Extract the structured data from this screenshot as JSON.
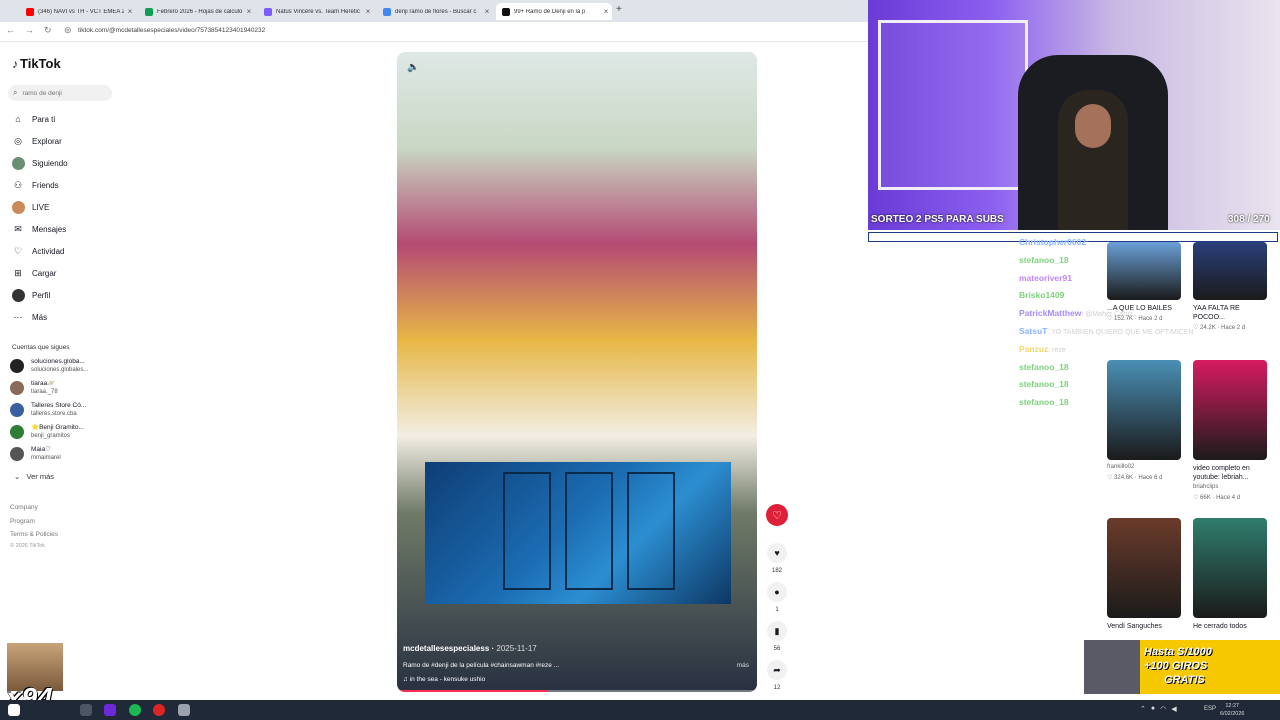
{
  "browser": {
    "tabs": [
      {
        "label": "(346) NAVI vs TH - VCT EMEA 2",
        "color": "#ff0000",
        "active": false
      },
      {
        "label": "Febrero 2026 - Hojas de cálculo",
        "color": "#0f9d58",
        "active": false
      },
      {
        "label": "Natus Vincere vs. Team Heretic",
        "color": "#7b5cff",
        "active": false
      },
      {
        "label": "denji ramo de flores - Buscar c",
        "color": "#4285f4",
        "active": false
      },
      {
        "label": "99+ Ramo de Denji en la p",
        "color": "#111111",
        "active": true
      }
    ],
    "new_tab": "+",
    "url": "tiktok.com/@mcdetallesespeciales/video/7573854123401940232"
  },
  "sidebar": {
    "brand": "TikTok",
    "search_placeholder": "ramo de denji",
    "nav": [
      {
        "label": "Para ti",
        "icon": "home-icon",
        "glyph": "⌂"
      },
      {
        "label": "Explorar",
        "icon": "compass-icon",
        "glyph": "◎"
      },
      {
        "label": "Siguiendo",
        "icon": "following-icon",
        "glyph": "●"
      },
      {
        "label": "Friends",
        "icon": "friends-icon",
        "glyph": "⚇"
      },
      {
        "label": "LIVE",
        "icon": "live-icon",
        "glyph": "●"
      },
      {
        "label": "Mensajes",
        "icon": "messages-icon",
        "glyph": "✉"
      },
      {
        "label": "Actividad",
        "icon": "activity-icon",
        "glyph": "♡"
      },
      {
        "label": "Cargar",
        "icon": "upload-icon",
        "glyph": "⊞"
      },
      {
        "label": "Perfil",
        "icon": "profile-icon",
        "glyph": "●"
      },
      {
        "label": "Más",
        "icon": "more-icon",
        "glyph": "⋯"
      }
    ],
    "following_title": "Cuentas que sigues",
    "following": [
      {
        "name": "soluciones.globa...",
        "handle": "soluciones.globales...",
        "color": "#222222"
      },
      {
        "name": "tiaraa🪐",
        "handle": "tiaraa._78",
        "color": "#8a6a5a"
      },
      {
        "name": "Talleres Store Có...",
        "handle": "talleres.store.cba",
        "color": "#3a5fa0"
      },
      {
        "name": "⭐Benji Gramito...",
        "handle": "benji_gramitos",
        "color": "#2e7d32"
      },
      {
        "name": "Maia♡",
        "handle": "mmaimarel",
        "color": "#555555"
      }
    ],
    "see_more": "Ver más",
    "footer": [
      "Company",
      "Program",
      "Terms & Policies"
    ],
    "copyright": "© 2026 TikTok"
  },
  "video": {
    "author": "mcdetallesespecialess",
    "date": "2025-11-17",
    "description": "Ramo de #denji de la película #chainsawman #reze ...",
    "more": "más",
    "music": "♫  in the sea - kensuke ushio",
    "progress": 0.42
  },
  "actions": [
    {
      "name": "like",
      "glyph": "♥",
      "count": "182"
    },
    {
      "name": "comment",
      "glyph": "●",
      "count": "1"
    },
    {
      "name": "bookmark",
      "glyph": "▮",
      "count": "56"
    },
    {
      "name": "share",
      "glyph": "➦",
      "count": "12"
    }
  ],
  "stream": {
    "title": "SORTEO 2 PS5 PARA SUBS",
    "counter": "308 / 270",
    "chat": [
      {
        "user": "Christopher0602",
        "color": "#8ab4ff",
        "msg": ": ... "
      },
      {
        "user": "stefanoo_18",
        "color": "#7fd17f",
        "msg": ""
      },
      {
        "user": "mateoriver91",
        "color": "#c084fc",
        "msg": ""
      },
      {
        "user": "Brisko1409",
        "color": "#7fd17f",
        "msg": ""
      },
      {
        "user": "PatrickMatthew",
        "color": "#a78bfa",
        "msg": ": @Maher Carriz.."
      },
      {
        "user": "SatsuT",
        "color": "#8ab4ff",
        "msg": ": YO TAMBIEN QUIERO QUE ME OPTIMICEN"
      },
      {
        "user": "Panzuz",
        "color": "#f5d76e",
        "msg": ": reze"
      },
      {
        "user": "stefanoo_18",
        "color": "#7fd17f",
        "msg": ""
      },
      {
        "user": "stefanoo_18",
        "color": "#7fd17f",
        "msg": ""
      },
      {
        "user": "stefanoo_18",
        "color": "#7fd17f",
        "msg": ""
      }
    ]
  },
  "feed": [
    {
      "caption": "...A QUE LO BAILES",
      "author": "",
      "likes": "152.7K",
      "age": "Hace 2 d",
      "color": "#6aa0d8"
    },
    {
      "caption": "YAA FALTA RE POCOO...",
      "author": "",
      "likes": "24.2K",
      "age": "Hace 2 d",
      "color": "#2a3f7a"
    },
    {
      "caption": "",
      "author": "frankillo02",
      "likes": "324.6K",
      "age": "Hace 6 d",
      "color": "#4a8fb5"
    },
    {
      "caption": "video completo en youtube: lebriah...",
      "author": "briahclips",
      "likes": "66K",
      "age": "Hace 4 d",
      "color": "#d81b60"
    },
    {
      "caption": "Vendí Sanguches",
      "author": "",
      "likes": "",
      "age": "",
      "color": "#6b3b2a"
    },
    {
      "caption": "He cerrado todos",
      "author": "",
      "likes": "",
      "age": "",
      "color": "#2f7d6d"
    }
  ],
  "promo": {
    "line1": "Hasta S/1000",
    "line2": "+100 GIROS",
    "line3": "GRATIS"
  },
  "emote_label": "x94",
  "taskbar": {
    "lang": "ESP",
    "time": "12:27",
    "date": "6/02/2026"
  }
}
